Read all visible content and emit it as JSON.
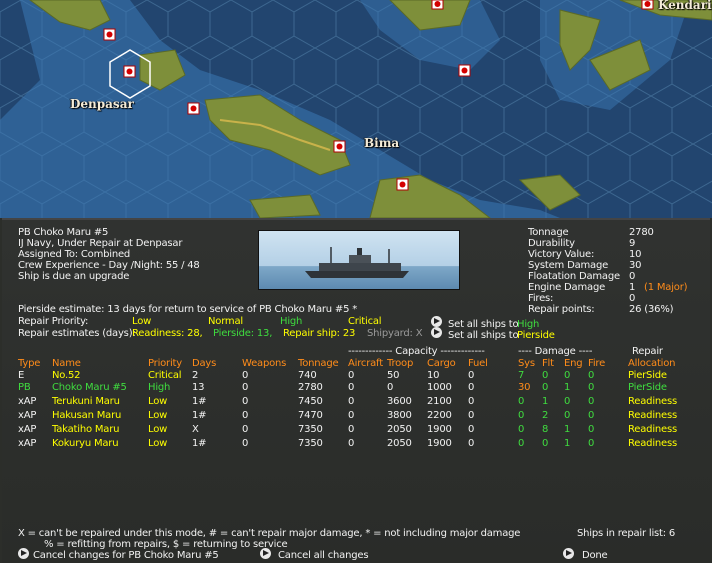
{
  "map": {
    "towns": [
      "Denpasar",
      "Bima",
      "Kendari"
    ]
  },
  "ship": {
    "name": "PB Choko Maru #5",
    "status": "IJ Navy, Under Repair at Denpasar",
    "assigned": "Assigned To:    Combined",
    "crew": "Crew Experience - Day /Night:  55  /  48",
    "note": "Ship is due an upgrade"
  },
  "stats": [
    {
      "label": "Tonnage",
      "value": "2780",
      "extra": ""
    },
    {
      "label": "Durability",
      "value": "9",
      "extra": ""
    },
    {
      "label": "Victory Value:",
      "value": "10",
      "extra": ""
    },
    {
      "label": "System Damage",
      "value": "30",
      "extra": ""
    },
    {
      "label": "Floatation Damage",
      "value": "0",
      "extra": ""
    },
    {
      "label": "Engine Damage",
      "value": "1",
      "extra": "(1 Major)"
    },
    {
      "label": "Fires:",
      "value": "0",
      "extra": ""
    },
    {
      "label": "Repair points:",
      "value": "26 (36%)",
      "extra": ""
    }
  ],
  "repair": {
    "estimate": "Pierside estimate: 13 days for return to service of PB Choko Maru #5  *",
    "priority_label": "Repair Priority:",
    "low": "Low",
    "normal": "Normal",
    "high": "High",
    "critical": "Critical",
    "estimates_label": "Repair estimates (days):",
    "readiness_est": "Readiness: 28,",
    "pierside_est": "Pierside: 13,",
    "repairship_est": "Repair ship: 23",
    "shipyard_est": "Shipyard: X",
    "set_all_1_prefix": "Set all ships to",
    "set_all_1_value": "High",
    "set_all_2_prefix": "Set all ships to",
    "set_all_2_value": "Pierside"
  },
  "table": {
    "capacity_header": "------------- Capacity -------------",
    "damage_header": "---- Damage ----",
    "repair_header": "Repair",
    "columns": [
      "Type",
      "Name",
      "Priority",
      "Days",
      "Weapons",
      "Tonnage",
      "Aircraft",
      "Troop",
      "Cargo",
      "Fuel",
      "Sys",
      "Flt",
      "Eng",
      "Fire",
      "Allocation"
    ],
    "rows": [
      {
        "type": "E",
        "name": "No.52",
        "priority": "Critical",
        "days": "2",
        "weapons": "0",
        "tonnage": "740",
        "aircraft": "0",
        "troop": "50",
        "cargo": "10",
        "fuel": "0",
        "sys": "7",
        "flt": "0",
        "eng": "0",
        "fire": "0",
        "alloc": "PierSide"
      },
      {
        "type": "PB",
        "name": "Choko Maru #5",
        "priority": "High",
        "days": "13",
        "weapons": "0",
        "tonnage": "2780",
        "aircraft": "0",
        "troop": "0",
        "cargo": "1000",
        "fuel": "0",
        "sys": "30",
        "flt": "0",
        "eng": "1",
        "fire": "0",
        "alloc": "PierSide"
      },
      {
        "type": "xAP",
        "name": "Terukuni Maru",
        "priority": "Low",
        "days": "1#",
        "weapons": "0",
        "tonnage": "7450",
        "aircraft": "0",
        "troop": "3600",
        "cargo": "2100",
        "fuel": "0",
        "sys": "0",
        "flt": "1",
        "eng": "0",
        "fire": "0",
        "alloc": "Readiness"
      },
      {
        "type": "xAP",
        "name": "Hakusan Maru",
        "priority": "Low",
        "days": "1#",
        "weapons": "0",
        "tonnage": "7470",
        "aircraft": "0",
        "troop": "3800",
        "cargo": "2200",
        "fuel": "0",
        "sys": "0",
        "flt": "2",
        "eng": "0",
        "fire": "0",
        "alloc": "Readiness"
      },
      {
        "type": "xAP",
        "name": "Takatiho Maru",
        "priority": "Low",
        "days": "X",
        "weapons": "0",
        "tonnage": "7350",
        "aircraft": "0",
        "troop": "2050",
        "cargo": "1900",
        "fuel": "0",
        "sys": "0",
        "flt": "8",
        "eng": "1",
        "fire": "0",
        "alloc": "Readiness"
      },
      {
        "type": "xAP",
        "name": "Kokuryu Maru",
        "priority": "Low",
        "days": "1#",
        "weapons": "0",
        "tonnage": "7350",
        "aircraft": "0",
        "troop": "2050",
        "cargo": "1900",
        "fuel": "0",
        "sys": "0",
        "flt": "0",
        "eng": "1",
        "fire": "0",
        "alloc": "Readiness"
      }
    ]
  },
  "footer": {
    "legend1": "X = can't be repaired under this mode, # = can't repair major damage, * = not including major damage",
    "legend2": "% = refitting from repairs, $ = returning to service",
    "ships_in_list": "Ships in repair list: 6",
    "cancel_ship": "Cancel changes for PB Choko Maru #5",
    "cancel_all": "Cancel all changes",
    "done": "Done"
  },
  "colors": {
    "ocean": "#22456f",
    "land": "#7e8f3a",
    "text_yellow": "#ffff00",
    "text_green": "#3fdc3f",
    "text_orange": "#ff8c1a"
  }
}
